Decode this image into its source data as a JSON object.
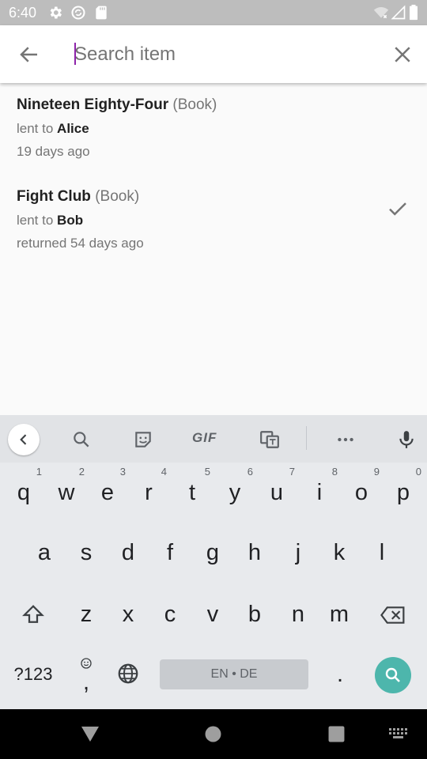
{
  "status_bar": {
    "time": "6:40",
    "icons": [
      "settings-icon",
      "sync-icon",
      "sd-card-icon",
      "wifi-icon",
      "signal-icon",
      "battery-icon"
    ]
  },
  "search": {
    "placeholder": "Search item",
    "value": "",
    "back_icon": "arrow-back-icon",
    "clear_icon": "close-icon"
  },
  "items": [
    {
      "title": "Nineteen Eighty-Four",
      "type": "(Book)",
      "lent_prefix": "lent to ",
      "person": "Alice",
      "time_text": "19 days ago",
      "returned": false
    },
    {
      "title": "Fight Club",
      "type": "(Book)",
      "lent_prefix": "lent to ",
      "person": "Bob",
      "time_text": "returned 54 days ago",
      "returned": true
    }
  ],
  "keyboard": {
    "row1": [
      {
        "k": "q",
        "h": "1"
      },
      {
        "k": "w",
        "h": "2"
      },
      {
        "k": "e",
        "h": "3"
      },
      {
        "k": "r",
        "h": "4"
      },
      {
        "k": "t",
        "h": "5"
      },
      {
        "k": "y",
        "h": "6"
      },
      {
        "k": "u",
        "h": "7"
      },
      {
        "k": "i",
        "h": "8"
      },
      {
        "k": "o",
        "h": "9"
      },
      {
        "k": "p",
        "h": "0"
      }
    ],
    "row2": [
      "a",
      "s",
      "d",
      "f",
      "g",
      "h",
      "j",
      "k",
      "l"
    ],
    "row3": [
      "z",
      "x",
      "c",
      "v",
      "b",
      "n",
      "m"
    ],
    "symbols_label": "?123",
    "comma": ",",
    "period": ".",
    "space_label": "EN • DE",
    "gif_label": "GIF",
    "accent_color": "#4db6ac"
  }
}
